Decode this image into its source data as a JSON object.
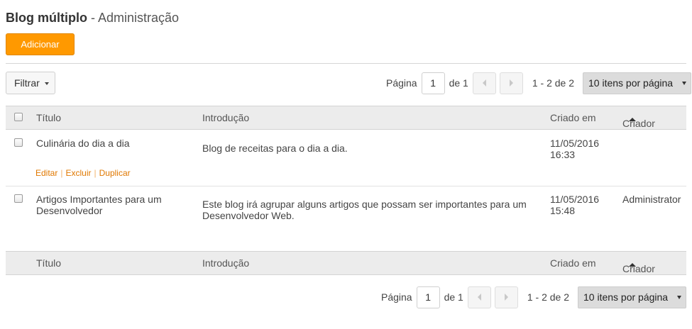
{
  "header": {
    "title_strong": "Blog múltiplo",
    "title_rest": " - Administração"
  },
  "toolbar": {
    "add_label": "Adicionar",
    "filter_label": "Filtrar"
  },
  "pagination": {
    "page_label": "Página",
    "current_page": "1",
    "of_label": "de 1",
    "range_label": "1 - 2 de 2",
    "per_page_label": "10 itens por página"
  },
  "table": {
    "columns": [
      "Título",
      "Introdução",
      "Criado em",
      "Criador"
    ],
    "rows": [
      {
        "title": "Culinária do dia a dia",
        "intro": "Blog de receitas para o dia a dia.",
        "created_date": "11/05/2016",
        "created_time": "16:33",
        "creator": "",
        "actions": [
          "Editar",
          "Excluir",
          "Duplicar"
        ]
      },
      {
        "title_line1": "Artigos Importantes para um",
        "title_line2": "Desenvolvedor",
        "intro_line1": "Este blog irá agrupar alguns artigos que possam ser importantes para um",
        "intro_line2": "Desenvolvedor Web.",
        "created_date": "11/05/2016",
        "created_time": "15:48",
        "creator": "Administrator"
      }
    ]
  },
  "colors": {
    "accent": "#ff9900",
    "link": "#e07800",
    "header_bg": "#ececec"
  }
}
